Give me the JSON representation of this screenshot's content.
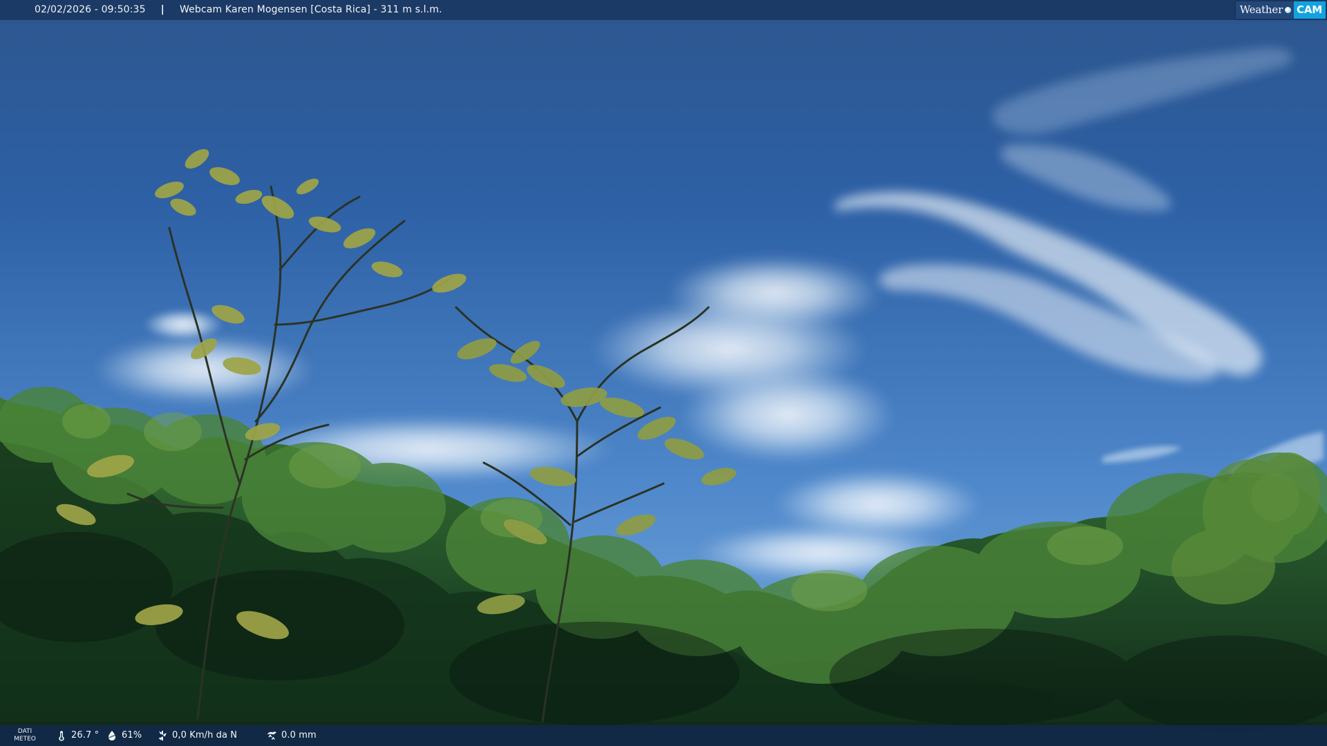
{
  "top_bar": {
    "timestamp": "02/02/2026 - 09:50:35",
    "separator": "|",
    "title": "Webcam Karen Mogensen [Costa Rica] - 311 m s.l.m.",
    "brand_weather": "Weather",
    "brand_cam": "CAM"
  },
  "weather": {
    "label_line1": "DATI",
    "label_line2": "METEO",
    "temperature": "26.7 °",
    "humidity": "61%",
    "wind": "0,0 Km/h da N",
    "rain": "0.0 mm"
  },
  "icons": {
    "temperature": "thermometer-icon",
    "humidity": "humidity-icon",
    "wind": "wind-icon",
    "rain": "rain-gauge-icon",
    "brand_dot": "sun-dot-icon"
  },
  "colors": {
    "sky_top": "#4f84c5",
    "sky_middle": "#2f65aa",
    "sky_bottom": "#4f8ed1",
    "foliage_dark": "#163818",
    "foliage_mid": "#2f6a2e",
    "foliage_light": "#7ea448",
    "brand_cam": "#11a3df"
  }
}
